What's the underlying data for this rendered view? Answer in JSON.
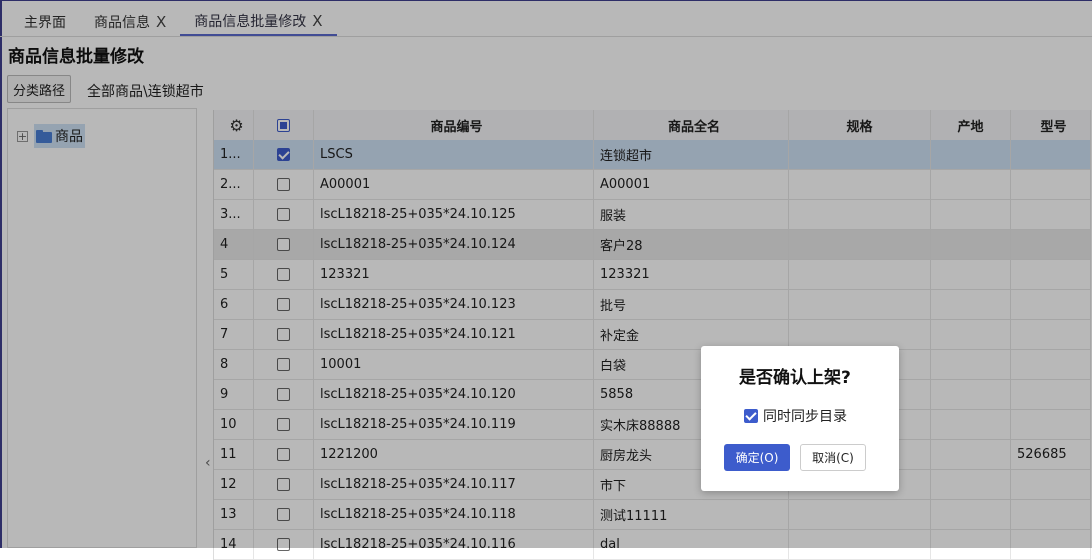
{
  "tabs": [
    {
      "label": "主界面",
      "closable": false
    },
    {
      "label": "商品信息",
      "closable": true
    },
    {
      "label": "商品信息批量修改",
      "closable": true,
      "active": true
    }
  ],
  "close_glyph": "X",
  "page_title": "商品信息批量修改",
  "category_path_button": "分类路径",
  "category_path_value": "全部商品\\连锁超市",
  "tree": {
    "expander_glyph": "+",
    "root_label": "商品"
  },
  "grid": {
    "headers": [
      "",
      "",
      "商品编号",
      "商品全名",
      "规格",
      "产地",
      "型号"
    ],
    "rows": [
      {
        "idx": "1...",
        "code": "LSCS",
        "name": "连锁超市",
        "spec": "",
        "origin": "",
        "model": "",
        "checked": true,
        "state": "selected"
      },
      {
        "idx": "2...",
        "code": "A00001",
        "name": "A00001",
        "spec": "",
        "origin": "",
        "model": "",
        "checked": false
      },
      {
        "idx": "3...",
        "code": "lscL18218-25+035*24.10.125",
        "name": "服装",
        "spec": "",
        "origin": "",
        "model": "",
        "checked": false
      },
      {
        "idx": "4",
        "code": "lscL18218-25+035*24.10.124",
        "name": "客户28",
        "spec": "",
        "origin": "",
        "model": "",
        "checked": false,
        "state": "hover"
      },
      {
        "idx": "5",
        "code": "123321",
        "name": "123321",
        "spec": "",
        "origin": "",
        "model": "",
        "checked": false
      },
      {
        "idx": "6",
        "code": "lscL18218-25+035*24.10.123",
        "name": "批号",
        "spec": "",
        "origin": "",
        "model": "",
        "checked": false
      },
      {
        "idx": "7",
        "code": "lscL18218-25+035*24.10.121",
        "name": "补定金",
        "spec": "",
        "origin": "",
        "model": "",
        "checked": false
      },
      {
        "idx": "8",
        "code": "10001",
        "name": "白袋",
        "spec": "",
        "origin": "",
        "model": "",
        "checked": false
      },
      {
        "idx": "9",
        "code": "lscL18218-25+035*24.10.120",
        "name": "5858",
        "spec": "",
        "origin": "",
        "model": "",
        "checked": false
      },
      {
        "idx": "10",
        "code": "lscL18218-25+035*24.10.119",
        "name": "实木床88888",
        "spec": "",
        "origin": "",
        "model": "",
        "checked": false
      },
      {
        "idx": "11",
        "code": "1221200",
        "name": "厨房龙头",
        "spec": "",
        "origin": "",
        "model": "526685",
        "checked": false
      },
      {
        "idx": "12",
        "code": "lscL18218-25+035*24.10.117",
        "name": "市下",
        "spec": "",
        "origin": "",
        "model": "",
        "checked": false
      },
      {
        "idx": "13",
        "code": "lscL18218-25+035*24.10.118",
        "name": "测试11111",
        "spec": "",
        "origin": "",
        "model": "",
        "checked": false
      },
      {
        "idx": "14",
        "code": "lscL18218-25+035*24.10.116",
        "name": "dal",
        "spec": "",
        "origin": "",
        "model": "",
        "checked": false
      }
    ]
  },
  "dialog": {
    "title": "是否确认上架?",
    "checkbox_label": "同时同步目录",
    "checkbox_checked": true,
    "ok_label": "确定(O)",
    "cancel_label": "取消(C)"
  },
  "colors": {
    "accent": "#3d5ccc",
    "selected_row": "#cfe2f6",
    "folder": "#4a7fd6"
  },
  "icons": {
    "settings": "gear-icon",
    "folder": "folder-icon",
    "collapse": "chevron-left-icon"
  }
}
